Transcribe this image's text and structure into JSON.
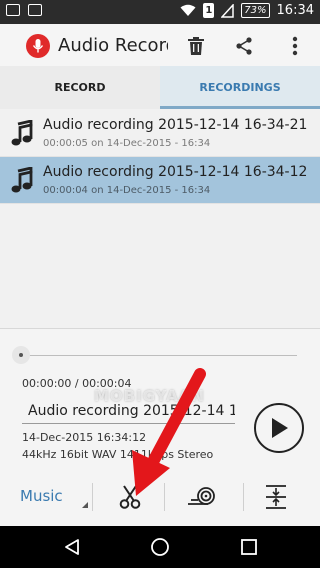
{
  "status_bar": {
    "sim_label": "1",
    "battery": "73%",
    "time": "16:34"
  },
  "app": {
    "title": "Audio Recorder"
  },
  "tabs": [
    {
      "label": "RECORD",
      "active": false
    },
    {
      "label": "RECORDINGS",
      "active": true
    }
  ],
  "recordings": [
    {
      "name": "Audio recording 2015-12-14 16-34-21",
      "meta": "00:00:05 on 14-Dec-2015 - 16:34",
      "selected": false
    },
    {
      "name": "Audio recording 2015-12-14 16-34-12",
      "meta": "00:00:04 on 14-Dec-2015 - 16:34",
      "selected": true
    }
  ],
  "player": {
    "time": "00:00:00 / 00:00:04",
    "name_field": "Audio recording 2015-12-14 1",
    "date": "14-Dec-2015 16:34:12",
    "format": "44kHz 16bit WAV 1411kbps Stereo",
    "position": 0
  },
  "tools": {
    "category": "Music"
  },
  "watermark": "MOBIGYAAN",
  "colors": {
    "accent": "#3b7bb0",
    "selected_row": "#a3c4dc",
    "record_red": "#e02a2a",
    "annotation_arrow": "#e3171b"
  },
  "icons": [
    "wifi-icon",
    "signal-icon",
    "battery-icon",
    "microphone-icon",
    "trash-icon",
    "share-icon",
    "overflow-menu-icon",
    "music-note-icon",
    "play-icon",
    "scissors-icon",
    "sound-effects-icon",
    "expand-icon",
    "back-icon",
    "home-icon",
    "recents-icon"
  ]
}
